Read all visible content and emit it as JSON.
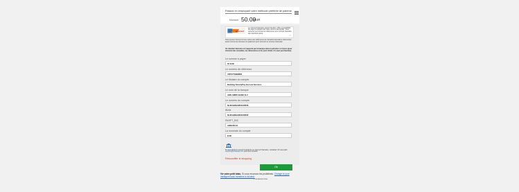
{
  "header": {
    "method_select": "Passez en employant votre méthode préférée de paiement",
    "amount_label": "Montant",
    "amount_value": "50.00",
    "currency": "EUR"
  },
  "notice": {
    "logo_text": "Virement",
    "text": "Le virement bancaire (aussi transfert, offre et possibilité de payer la plupart des sites comme demande). Vous recevrez sur l'écran les références et le compte bancaire des transferts aimé.",
    "close_label": "×"
  },
  "info": {
    "line1": "Vous pouvez trouver ici tous sortes des références de transferts bancaires (virements) aussi comme les données du paiement pour virement et virement bancaire.",
    "line2": "Un transfert bancaire est rapporté par la banque dans la période 1 à 3 jours (pour virement des nouvelles, les dimensions et les jours fériés s'il, avez peu bancais)."
  },
  "fields": [
    {
      "label": "Le somme à payer",
      "value": "52 EUR"
    },
    {
      "label": "Le numéro de référence",
      "value": "VRT0779999883"
    },
    {
      "label": "Le titulaire du compte",
      "value": "Banking SmartyPay Escrow Services"
    },
    {
      "label": "Le nom de la banque",
      "value": "ABN AMRO BANK N.V."
    },
    {
      "label": "Le numéro du compte",
      "value": "NL82ABNA0861128558"
    },
    {
      "label": "IBAN",
      "value": "NL82ABNA0861128558"
    },
    {
      "label": "SWIFT_BIC",
      "value": "ABNANL2A"
    },
    {
      "label": "La monnaie du compte",
      "value": "EUR"
    }
  ],
  "contact": {
    "text": "Si vous désirez recevoir l'extrait de ce virement bancaire, contactez s'il vous plaît",
    "link": "support@smartpay.com",
    "text2": "pour des conseils."
  },
  "back_link": "Rétourniffer le shopping",
  "ok_button": "Ok",
  "cookie": {
    "bold": "Vie votre petit biais.",
    "text": "Si vous renoncez les problèmes.",
    "link": "Change to your intelligent back transfers to kindest.",
    "close": "× rendement cloe"
  },
  "colors": {
    "accent_green": "#1f9a3a",
    "link_blue": "#1a5fb4",
    "back_link_red": "#c0392b"
  }
}
